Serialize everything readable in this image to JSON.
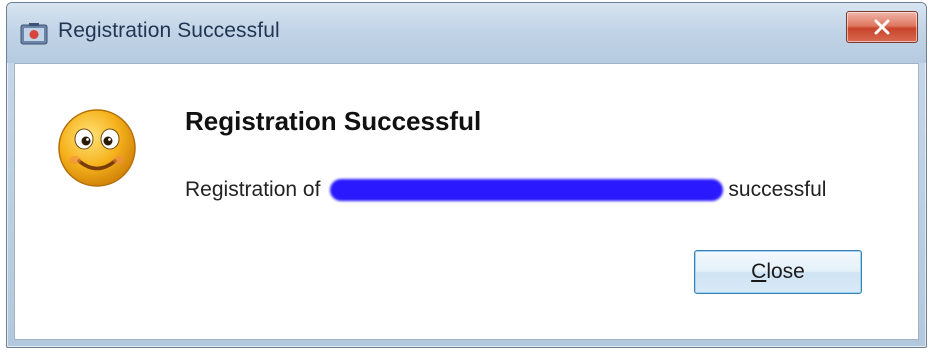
{
  "window": {
    "title": "Registration Successful",
    "close_glyph": "x"
  },
  "dialog": {
    "icon": "smiley-face-icon",
    "heading": "Registration Successful",
    "message_prefix": "Registration of",
    "message_suffix": "successful",
    "redaction_color": "#2a18ff"
  },
  "buttons": {
    "close_label_mnemonic": "C",
    "close_label_rest": "lose"
  }
}
